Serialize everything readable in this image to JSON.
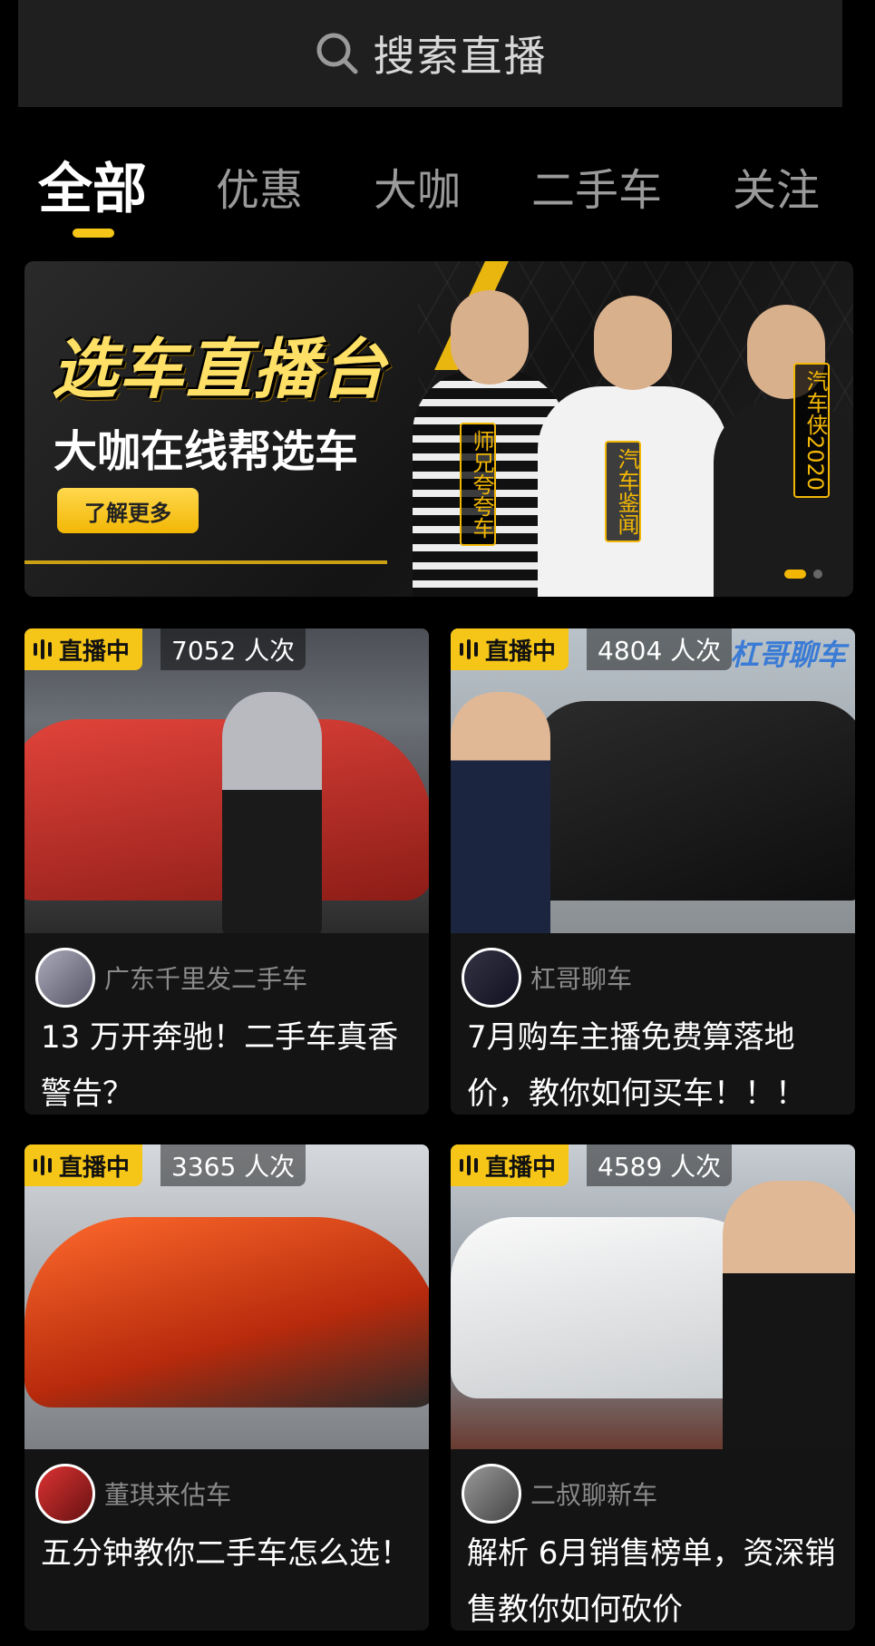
{
  "search": {
    "placeholder": "搜索直播"
  },
  "tabs": [
    {
      "label": "全部",
      "active": true
    },
    {
      "label": "优惠",
      "active": false
    },
    {
      "label": "大咖",
      "active": false
    },
    {
      "label": "二手车",
      "active": false
    },
    {
      "label": "关注",
      "active": false
    }
  ],
  "banner": {
    "title": "选车直播台",
    "subtitle": "大咖在线帮选车",
    "button": "了解更多",
    "hosts": [
      "师兄夸夸车",
      "汽车鉴闻",
      "汽车侠2020"
    ]
  },
  "cards": [
    {
      "badge": "直播中",
      "viewers": "7052 人次",
      "author": "广东千里发二手车",
      "title": "13 万开奔驰！二手车真香警告？"
    },
    {
      "badge": "直播中",
      "viewers": "4804 人次",
      "author": "杠哥聊车",
      "title": "7月购车主播免费算落地价，教你如何买车！！！",
      "thumb_text": "杠哥聊车"
    },
    {
      "badge": "直播中",
      "viewers": "3365 人次",
      "author": "董琪来估车",
      "title": "五分钟教你二手车怎么选！"
    },
    {
      "badge": "直播中",
      "viewers": "4589 人次",
      "author": "二叔聊新车",
      "title": "解析 6月销售榜单，资深销售教你如何砍价"
    }
  ],
  "colors": {
    "accent": "#f5c518",
    "background": "#000000",
    "card": "#141414"
  }
}
